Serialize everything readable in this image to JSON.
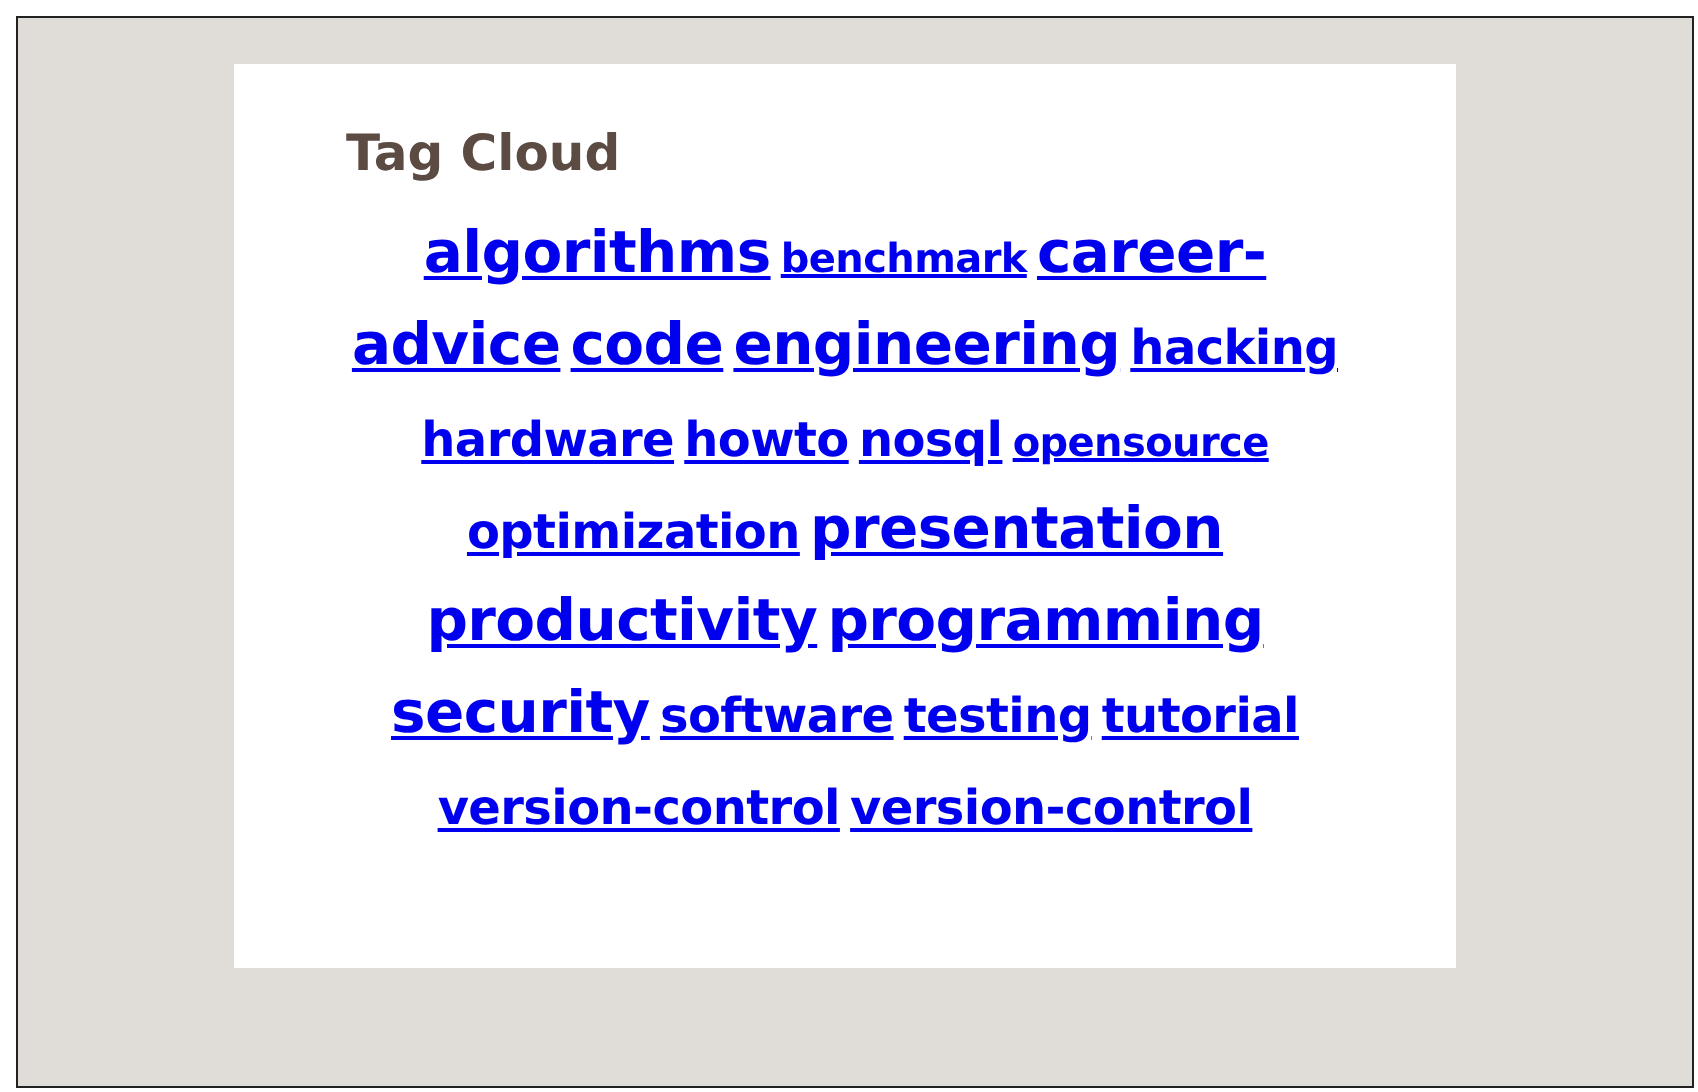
{
  "title": "Tag Cloud",
  "tags": [
    {
      "label": "algorithms",
      "kind": "large"
    },
    {
      "label": "benchmark",
      "kind": "small"
    },
    {
      "label": "career-",
      "kind": "large"
    },
    {
      "label": "advice",
      "kind": "large"
    },
    {
      "label": "code",
      "kind": "large"
    },
    {
      "label": "engineering",
      "kind": "large"
    },
    {
      "label": "hacking",
      "kind": "medium"
    },
    {
      "label": "hardware",
      "kind": "medium"
    },
    {
      "label": "howto",
      "kind": "medium"
    },
    {
      "label": "nosql",
      "kind": "medium"
    },
    {
      "label": "opensource",
      "kind": "small"
    },
    {
      "label": "optimization",
      "kind": "medium"
    },
    {
      "label": "presentation",
      "kind": "large"
    },
    {
      "label": "productivity",
      "kind": "large"
    },
    {
      "label": "programming",
      "kind": "large"
    },
    {
      "label": "security",
      "kind": "large"
    },
    {
      "label": "software",
      "kind": "medium"
    },
    {
      "label": "testing",
      "kind": "medium"
    },
    {
      "label": "tutorial",
      "kind": "medium"
    },
    {
      "label": "version-control",
      "kind": "medium"
    },
    {
      "label": "version-control",
      "kind": "medium"
    }
  ]
}
